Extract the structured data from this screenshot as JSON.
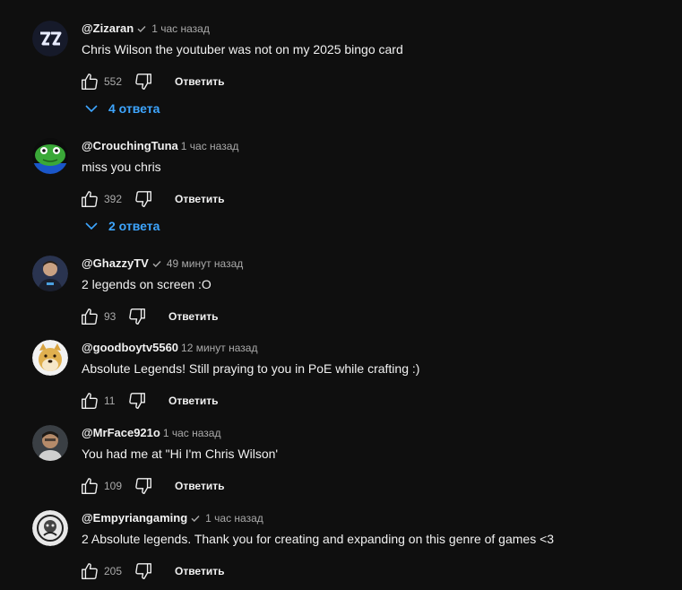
{
  "theme": {
    "background": "#0f0f0f",
    "text": "#f1f1f1",
    "muted": "#aaaaaa",
    "link": "#3ea6ff"
  },
  "comments": [
    {
      "author": "@Zizaran",
      "verified": true,
      "time": "1 час назад",
      "text": "Chris Wilson the youtuber was not on my 2025 bingo card",
      "likes": "552",
      "reply_label": "Ответить",
      "replies_label": "4 ответа",
      "avatar_icon": "zizaran-logo-avatar"
    },
    {
      "author": "@CrouchingTuna",
      "verified": false,
      "time": "1 час назад",
      "text": "miss you chris",
      "likes": "392",
      "reply_label": "Ответить",
      "replies_label": "2 ответа",
      "avatar_icon": "green-frog-avatar"
    },
    {
      "author": "@GhazzyTV",
      "verified": true,
      "time": "49 минут назад",
      "text": "2 legends on screen :O",
      "likes": "93",
      "reply_label": "Ответить",
      "avatar_icon": "person-photo-avatar"
    },
    {
      "author": "@goodboytv5560",
      "verified": false,
      "time": "12 минут назад",
      "text": "Absolute Legends! Still praying to you in PoE while crafting :)",
      "likes": "11",
      "reply_label": "Ответить",
      "avatar_icon": "doge-avatar"
    },
    {
      "author": "@MrFace921o",
      "verified": false,
      "time": "1 час назад",
      "text": "You had me at \"Hi I'm Chris Wilson'",
      "likes": "109",
      "reply_label": "Ответить",
      "avatar_icon": "face-photo-avatar"
    },
    {
      "author": "@Empyriangaming",
      "verified": true,
      "time": "1 час назад",
      "text": "2 Absolute legends. Thank you for creating and expanding on this genre of games <3",
      "likes": "205",
      "reply_label": "Ответить",
      "avatar_icon": "emblem-avatar"
    }
  ],
  "icons": {
    "like": "thumbs-up-icon",
    "dislike": "thumbs-down-icon",
    "verified": "verified-check-icon",
    "expand": "chevron-down-icon"
  }
}
